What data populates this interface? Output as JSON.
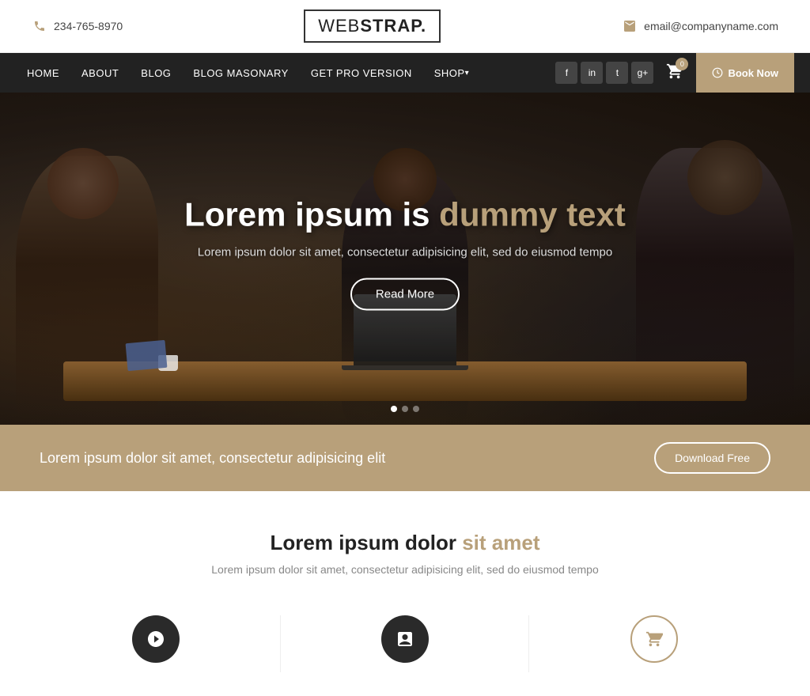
{
  "topbar": {
    "phone": "234-765-8970",
    "email": "email@companyname.com"
  },
  "logo": {
    "text_web": "WEB",
    "text_strap": "STRAP.",
    "full": "WEBSTRAP."
  },
  "navbar": {
    "links": [
      {
        "label": "HOME",
        "id": "home",
        "hasArrow": false
      },
      {
        "label": "ABOUT",
        "id": "about",
        "hasArrow": false
      },
      {
        "label": "BLOG",
        "id": "blog",
        "hasArrow": false
      },
      {
        "label": "BLOG MASONARY",
        "id": "blog-masonary",
        "hasArrow": false
      },
      {
        "label": "GET PRO VERSION",
        "id": "get-pro",
        "hasArrow": false
      },
      {
        "label": "SHOP",
        "id": "shop",
        "hasArrow": true
      }
    ],
    "social": [
      {
        "icon": "f",
        "id": "facebook"
      },
      {
        "icon": "in",
        "id": "linkedin"
      },
      {
        "icon": "t",
        "id": "twitter"
      },
      {
        "icon": "g+",
        "id": "google-plus"
      }
    ],
    "cart_count": "0",
    "book_now": "Book Now"
  },
  "hero": {
    "title_normal": "Lorem ipsum is",
    "title_accent": "dummy text",
    "subtitle": "Lorem ipsum dolor sit amet, consectetur adipisicing elit, sed do eiusmod tempo",
    "cta_button": "Read More",
    "dots": [
      true,
      false,
      false
    ]
  },
  "promo_banner": {
    "text": "Lorem ipsum dolor sit amet, consectetur adipisicing elit",
    "button": "Download Free"
  },
  "section": {
    "title_normal": "Lorem ipsum dolor",
    "title_accent": "sit amet",
    "subtitle": "Lorem ipsum dolor sit amet, consectetur adipisicing elit, sed do eiusmod tempo",
    "features": [
      {
        "icon": "⬡",
        "id": "feature-1"
      },
      {
        "icon": "▦",
        "id": "feature-2"
      },
      {
        "icon": "🛒",
        "id": "feature-3"
      }
    ]
  },
  "colors": {
    "accent": "#b8a07a",
    "dark": "#222222",
    "navbar_bg": "#222222"
  }
}
